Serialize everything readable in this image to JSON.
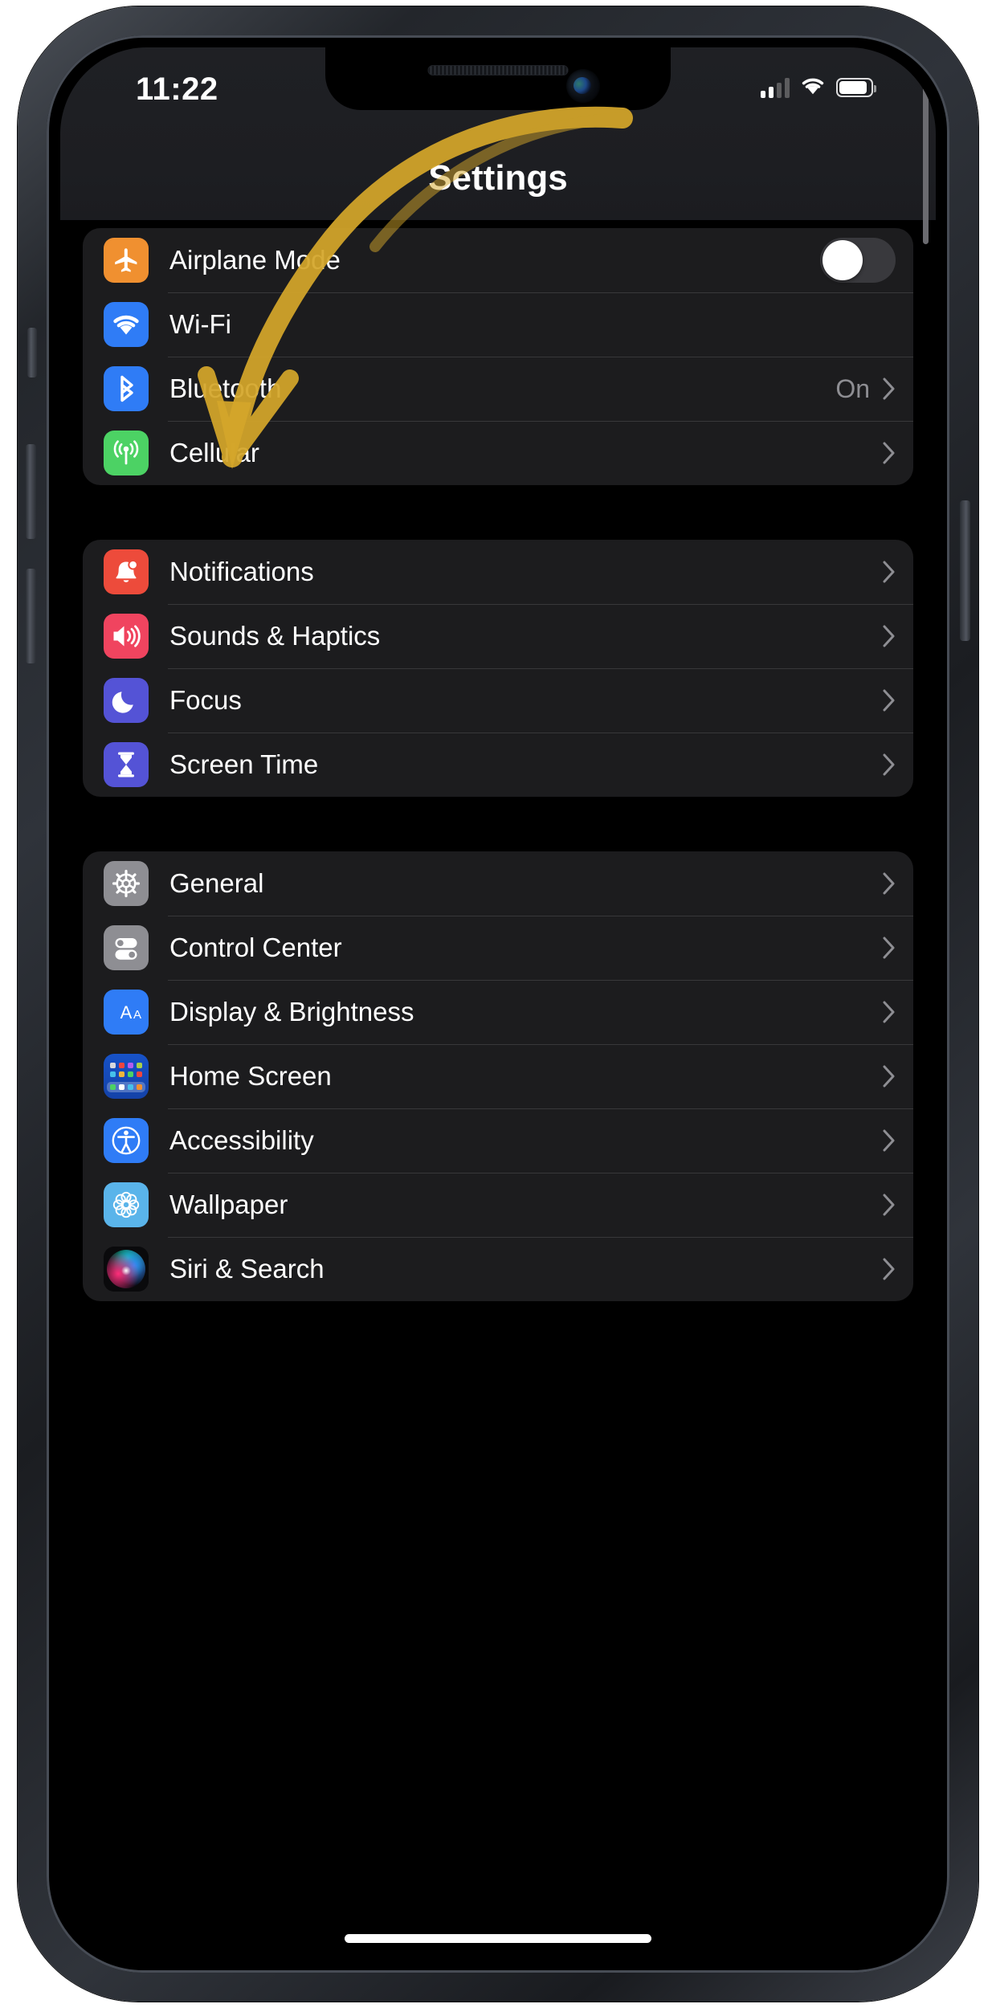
{
  "status_bar": {
    "time": "11:22",
    "signal_icon": "cellular-signal-icon",
    "wifi_icon": "wifi-icon",
    "battery_icon": "battery-icon"
  },
  "nav": {
    "title": "Settings"
  },
  "annotation": {
    "type": "hand-drawn-arrow",
    "color": "#d4a62a",
    "points_to": "Wi-Fi"
  },
  "groups": [
    {
      "id": "connectivity",
      "rows": [
        {
          "label": "Airplane Mode",
          "icon": "airplane-icon",
          "icon_color": "#f09030",
          "control": "toggle",
          "toggle_on": false,
          "value": "",
          "chevron": false
        },
        {
          "label": "Wi-Fi",
          "icon": "wifi-icon",
          "icon_color": "#2f7cf6",
          "control": "none",
          "value": "",
          "chevron": false
        },
        {
          "label": "Bluetooth",
          "icon": "bluetooth-icon",
          "icon_color": "#2f7cf6",
          "control": "value",
          "value": "On",
          "chevron": true
        },
        {
          "label": "Cellular",
          "icon": "cellular-antenna-icon",
          "icon_color": "#4cd264",
          "control": "value",
          "value": "",
          "chevron": true
        }
      ]
    },
    {
      "id": "alerts",
      "rows": [
        {
          "label": "Notifications",
          "icon": "bell-icon",
          "icon_color": "#ed4b3b",
          "control": "value",
          "value": "",
          "chevron": true
        },
        {
          "label": "Sounds & Haptics",
          "icon": "speaker-icon",
          "icon_color": "#f0445f",
          "control": "value",
          "value": "",
          "chevron": true
        },
        {
          "label": "Focus",
          "icon": "moon-icon",
          "icon_color": "#5453d6",
          "control": "value",
          "value": "",
          "chevron": true
        },
        {
          "label": "Screen Time",
          "icon": "hourglass-icon",
          "icon_color": "#5453d6",
          "control": "value",
          "value": "",
          "chevron": true
        }
      ]
    },
    {
      "id": "system",
      "rows": [
        {
          "label": "General",
          "icon": "gear-icon",
          "icon_color": "#8e8e93",
          "control": "value",
          "value": "",
          "chevron": true
        },
        {
          "label": "Control Center",
          "icon": "control-center-icon",
          "icon_color": "#8e8e93",
          "control": "value",
          "value": "",
          "chevron": true
        },
        {
          "label": "Display & Brightness",
          "icon": "display-aa-icon",
          "icon_color": "#2f7cf6",
          "control": "value",
          "value": "",
          "chevron": true
        },
        {
          "label": "Home Screen",
          "icon": "home-screen-grid-icon",
          "icon_color": "#1752c8",
          "control": "value",
          "value": "",
          "chevron": true
        },
        {
          "label": "Accessibility",
          "icon": "accessibility-icon",
          "icon_color": "#2f7cf6",
          "control": "value",
          "value": "",
          "chevron": true
        },
        {
          "label": "Wallpaper",
          "icon": "wallpaper-flower-icon",
          "icon_color": "#5ab4ea",
          "control": "value",
          "value": "",
          "chevron": true
        },
        {
          "label": "Siri & Search",
          "icon": "siri-orb-icon",
          "icon_color": "#0a0a0c",
          "control": "value",
          "value": "",
          "chevron": true
        }
      ]
    }
  ]
}
